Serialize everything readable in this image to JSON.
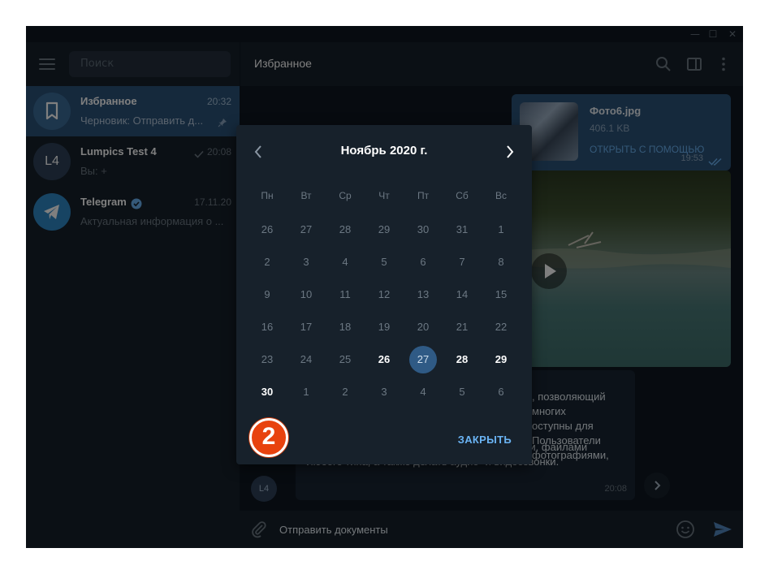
{
  "window": {
    "controls": {
      "minimize": "—",
      "maximize": "☐",
      "close": "✕"
    }
  },
  "sidebar": {
    "search_placeholder": "Поиск",
    "chats": [
      {
        "avatar_icon": "bookmark-icon",
        "avatar_color": "#3a6d99",
        "name": "Избранное",
        "time": "20:32",
        "preview": "Черновик: Отправить д...",
        "pinned": true,
        "active": true
      },
      {
        "avatar_text": "L4",
        "avatar_color": "#2e4159",
        "name": "Lumpics Test 4",
        "time": "20:08",
        "preview": "Вы: +",
        "read": true
      },
      {
        "avatar_icon": "telegram-icon",
        "avatar_color": "#2f88c7",
        "name": "Telegram",
        "verified": true,
        "time": "17.11.20",
        "preview": "Актуальная информация о ..."
      }
    ]
  },
  "chat": {
    "title": "Избранное",
    "file_message": {
      "name": "Фото6.jpg",
      "size": "406.1 KB",
      "action": "ОТКРЫТЬ С ПОМОЩЬЮ",
      "time": "19:53"
    },
    "text_message": {
      "peek_lines": [
        ", позволяющий",
        " многих",
        "оступны для",
        " Пользователи",
        " фотографиями,"
      ],
      "lines": [
        "стикерами, голосовыми и видео сообщениями, файлами",
        "любого типа, а также делать аудио- и видеозвонки."
      ],
      "time": "20:08",
      "avatar": "L4"
    },
    "composer_value": "Отправить документы"
  },
  "calendar": {
    "title": "Ноябрь 2020 г.",
    "weekdays": [
      "Пн",
      "Вт",
      "Ср",
      "Чт",
      "Пт",
      "Сб",
      "Вс"
    ],
    "weeks": [
      [
        "26",
        "27",
        "28",
        "29",
        "30",
        "31",
        "1"
      ],
      [
        "2",
        "3",
        "4",
        "5",
        "6",
        "7",
        "8"
      ],
      [
        "9",
        "10",
        "11",
        "12",
        "13",
        "14",
        "15"
      ],
      [
        "16",
        "17",
        "18",
        "19",
        "20",
        "21",
        "22"
      ],
      [
        "23",
        "24",
        "25",
        "26",
        "27",
        "28",
        "29"
      ],
      [
        "30",
        "1",
        "2",
        "3",
        "4",
        "5",
        "6"
      ]
    ],
    "enabled_days": [
      "26",
      "27",
      "28",
      "29",
      "30"
    ],
    "selected_day": "27",
    "close_label": "ЗАКРЫТЬ"
  },
  "annotation": {
    "step": "2",
    "color": "#e8420e"
  },
  "colors": {
    "accent": "#6ab3f3",
    "active_chat": "#2b5278",
    "background": "#0e1621",
    "panel": "#17212b"
  }
}
